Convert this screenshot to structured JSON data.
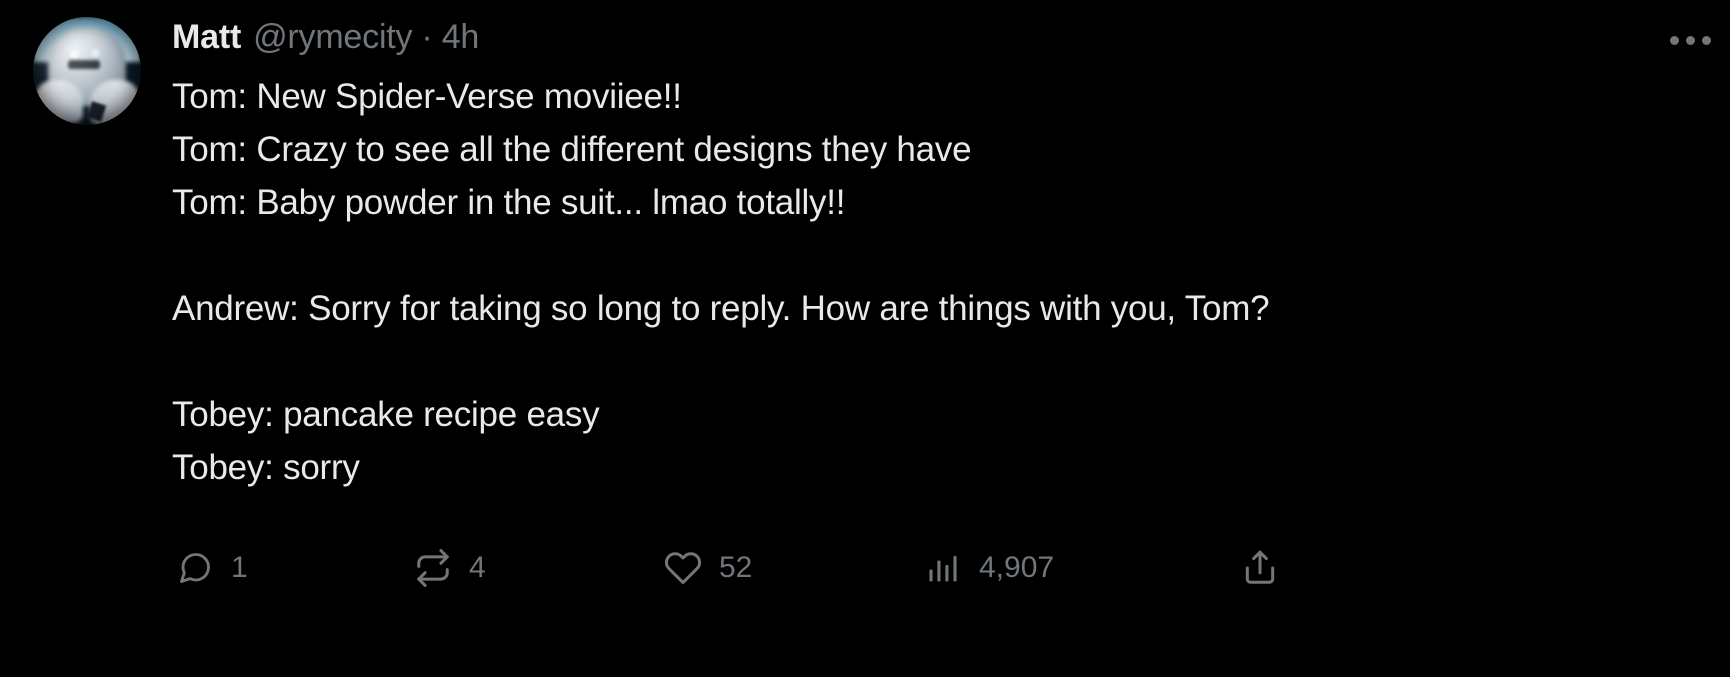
{
  "post": {
    "author": {
      "display_name": "Matt",
      "handle": "@rymecity",
      "separator": "·",
      "timestamp": "4h",
      "avatar_alt": "blurred-photo-avatar"
    },
    "body": "Tom: New Spider-Verse moviiee!!\nTom: Crazy to see all the different designs they have\nTom: Baby powder in the suit... lmao totally!!\n\nAndrew: Sorry for taking so long to reply. How are things with you, Tom?\n\nTobey: pancake recipe easy\nTobey: sorry",
    "more_menu_label": "More"
  },
  "actions": {
    "reply": {
      "icon": "reply-icon",
      "count": "1"
    },
    "retweet": {
      "icon": "retweet-icon",
      "count": "4"
    },
    "like": {
      "icon": "heart-icon",
      "count": "52"
    },
    "views": {
      "icon": "analytics-icon",
      "count": "4,907"
    },
    "share": {
      "icon": "share-icon",
      "count": ""
    }
  },
  "colors": {
    "background": "#000000",
    "primary_text": "#e7e9ea",
    "secondary_text": "#71767b"
  }
}
